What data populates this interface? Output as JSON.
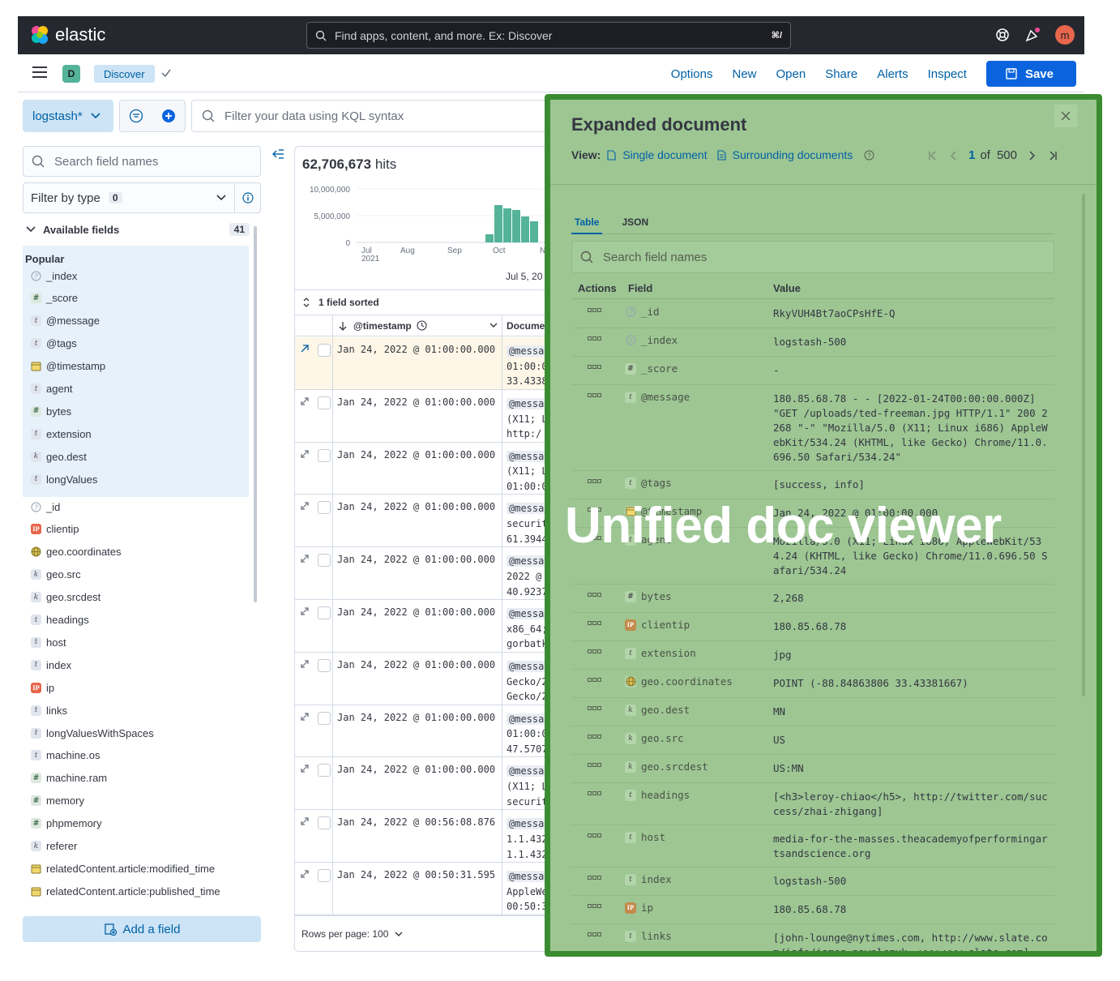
{
  "header": {
    "brand": "elastic",
    "search_placeholder": "Find apps, content, and more. Ex: Discover",
    "search_shortcut": "⌘/",
    "avatar_initial": "m"
  },
  "secondary": {
    "app_badge": "D",
    "breadcrumb": "Discover",
    "menu": [
      "Options",
      "New",
      "Open",
      "Share",
      "Alerts",
      "Inspect"
    ],
    "save_label": "Save"
  },
  "query": {
    "data_view": "logstash*",
    "kql_placeholder": "Filter your data using KQL syntax"
  },
  "sidebar": {
    "search_placeholder": "Search field names",
    "filter_by_type": "Filter by type",
    "filter_count": "0",
    "available_label": "Available fields",
    "available_count": "41",
    "popular_label": "Popular",
    "popular_fields": [
      {
        "name": "_index",
        "type": "?"
      },
      {
        "name": "_score",
        "type": "#"
      },
      {
        "name": "@message",
        "type": "t"
      },
      {
        "name": "@tags",
        "type": "t"
      },
      {
        "name": "@timestamp",
        "type": "date"
      },
      {
        "name": "agent",
        "type": "t"
      },
      {
        "name": "bytes",
        "type": "#"
      },
      {
        "name": "extension",
        "type": "t"
      },
      {
        "name": "geo.dest",
        "type": "k"
      },
      {
        "name": "longValues",
        "type": "t"
      }
    ],
    "other_fields": [
      {
        "name": "_id",
        "type": "?"
      },
      {
        "name": "clientip",
        "type": "ip"
      },
      {
        "name": "geo.coordinates",
        "type": "geo"
      },
      {
        "name": "geo.src",
        "type": "k"
      },
      {
        "name": "geo.srcdest",
        "type": "k"
      },
      {
        "name": "headings",
        "type": "t"
      },
      {
        "name": "host",
        "type": "t"
      },
      {
        "name": "index",
        "type": "t"
      },
      {
        "name": "ip",
        "type": "ip"
      },
      {
        "name": "links",
        "type": "t"
      },
      {
        "name": "longValuesWithSpaces",
        "type": "t"
      },
      {
        "name": "machine.os",
        "type": "t"
      },
      {
        "name": "machine.ram",
        "type": "#"
      },
      {
        "name": "memory",
        "type": "#"
      },
      {
        "name": "phpmemory",
        "type": "#"
      },
      {
        "name": "referer",
        "type": "k"
      },
      {
        "name": "relatedContent.article:modified_time",
        "type": "date"
      },
      {
        "name": "relatedContent.article:published_time",
        "type": "date"
      }
    ],
    "add_field_label": "Add a field"
  },
  "main": {
    "hits_count": "62,706,673",
    "hits_label": "hits",
    "histogram": {
      "y_ticks": [
        "10,000,000",
        "5,000,000",
        "0"
      ],
      "x_ticks": [
        "Jul\n2021",
        "Aug",
        "Sep",
        "Oct",
        "N"
      ],
      "caption": "Jul 5, 20"
    },
    "sorted_label": "1 field sorted",
    "col_timestamp": "@timestamp",
    "col_document": "Docume",
    "rows": [
      {
        "ts": "Jan 24, 2022 @ 01:00:00.000",
        "doc": [
          "@messa",
          "01:00:0",
          "33.4338"
        ]
      },
      {
        "ts": "Jan 24, 2022 @ 01:00:00.000",
        "doc": [
          "@messa",
          "(X11; L",
          "http:/"
        ]
      },
      {
        "ts": "Jan 24, 2022 @ 01:00:00.000",
        "doc": [
          "@messa",
          "(X11; L",
          "01:00:0"
        ]
      },
      {
        "ts": "Jan 24, 2022 @ 01:00:00.000",
        "doc": [
          "@messa",
          "securit",
          "61.3944"
        ]
      },
      {
        "ts": "Jan 24, 2022 @ 01:00:00.000",
        "doc": [
          "@messa",
          "2022 @",
          "40.9237"
        ]
      },
      {
        "ts": "Jan 24, 2022 @ 01:00:00.000",
        "doc": [
          "@messa",
          "x86_64;",
          "gorbatk"
        ]
      },
      {
        "ts": "Jan 24, 2022 @ 01:00:00.000",
        "doc": [
          "@messa",
          "Gecko/2",
          "Gecko/2"
        ]
      },
      {
        "ts": "Jan 24, 2022 @ 01:00:00.000",
        "doc": [
          "@messa",
          "01:00:0",
          "47.5707"
        ]
      },
      {
        "ts": "Jan 24, 2022 @ 01:00:00.000",
        "doc": [
          "@messa",
          "(X11; L",
          "securit"
        ]
      },
      {
        "ts": "Jan 24, 2022 @ 00:56:08.876",
        "doc": [
          "@messa",
          "1.1.432",
          "1.1.432"
        ]
      },
      {
        "ts": "Jan 24, 2022 @ 00:50:31.595",
        "doc": [
          "@messa",
          "AppleWe",
          "00:50:3"
        ]
      }
    ],
    "rows_per_page": "Rows per page: 100"
  },
  "flyout": {
    "title": "Expanded document",
    "view_label": "View:",
    "single_document": "Single document",
    "surrounding_documents": "Surrounding documents",
    "page_current": "1",
    "page_of": "of",
    "page_total": "500",
    "tabs": [
      "Table",
      "JSON"
    ],
    "search_placeholder": "Search field names",
    "col_actions": "Actions",
    "col_field": "Field",
    "col_value": "Value",
    "rows": [
      {
        "field": "_id",
        "type": "?",
        "value": "RkyVUH4Bt7aoCPsHfE-Q"
      },
      {
        "field": "_index",
        "type": "?",
        "value": "logstash-500"
      },
      {
        "field": "_score",
        "type": "#",
        "value": "-"
      },
      {
        "field": "@message",
        "type": "t",
        "value": "180.85.68.78 - - [2022-01-24T00:00:00.000Z] \"GET /uploads/ted-freeman.jpg HTTP/1.1\" 200 2268 \"-\" \"Mozilla/5.0 (X11; Linux i686) AppleWebKit/534.24 (KHTML, like Gecko) Chrome/11.0.696.50 Safari/534.24\""
      },
      {
        "field": "@tags",
        "type": "t",
        "value": "[success, info]"
      },
      {
        "field": "@timestamp",
        "type": "date",
        "value": "Jan 24, 2022 @ 01:00:00.000"
      },
      {
        "field": "agent",
        "type": "t",
        "value": "Mozilla/5.0 (X11; Linux i686) AppleWebKit/534.24 (KHTML, like Gecko) Chrome/11.0.696.50 Safari/534.24"
      },
      {
        "field": "bytes",
        "type": "#",
        "value": "2,268"
      },
      {
        "field": "clientip",
        "type": "ip",
        "value": "180.85.68.78"
      },
      {
        "field": "extension",
        "type": "t",
        "value": "jpg"
      },
      {
        "field": "geo.coordinates",
        "type": "geo",
        "value": "POINT (-88.84863806 33.43381667)"
      },
      {
        "field": "geo.dest",
        "type": "k",
        "value": "MN"
      },
      {
        "field": "geo.src",
        "type": "k",
        "value": "US"
      },
      {
        "field": "geo.srcdest",
        "type": "k",
        "value": "US:MN"
      },
      {
        "field": "headings",
        "type": "t",
        "value": "[<h3>leroy-chiao</h5>, http://twitter.com/success/zhai-zhigang]"
      },
      {
        "field": "host",
        "type": "t",
        "value": "media-for-the-masses.theacademyofperformingartsandscience.org"
      },
      {
        "field": "index",
        "type": "t",
        "value": "logstash-500"
      },
      {
        "field": "ip",
        "type": "ip",
        "value": "180.85.68.78"
      },
      {
        "field": "links",
        "type": "t",
        "value": "[john-lounge@nytimes.com, http://www.slate.com/info/james-pawelczyk, www.www.slate.com]"
      }
    ],
    "overlay_text": "Unified doc viewer"
  },
  "colors": {
    "accent": "#0b64dd",
    "highlight_fill": "#9dc693",
    "highlight_border": "#3b8c31"
  }
}
